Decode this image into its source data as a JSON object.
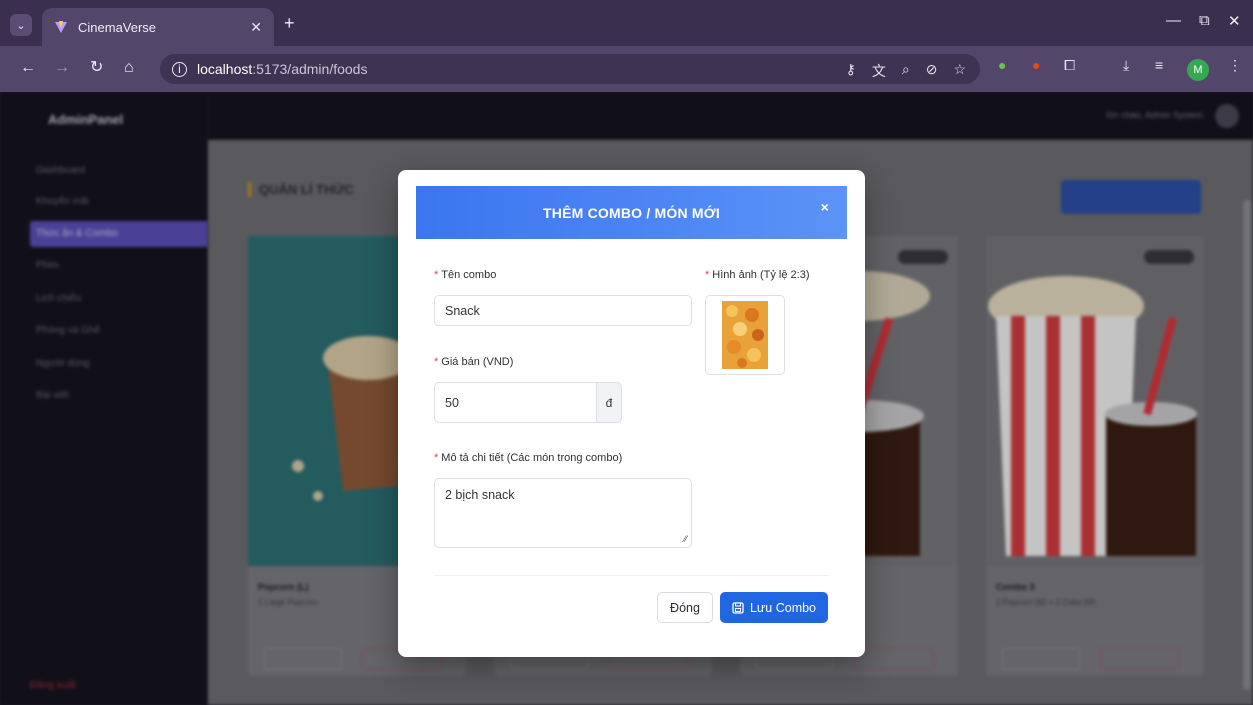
{
  "browser": {
    "tab_title": "CinemaVerse",
    "url_host": "localhost",
    "url_path": ":5173/admin/foods",
    "profile_initial": "M"
  },
  "app": {
    "brand": "AdminPanel",
    "sidebar": [
      {
        "label": "Dashboard",
        "active": false
      },
      {
        "label": "Khuyến mãi",
        "active": false
      },
      {
        "label": "Thức ăn & Combo",
        "active": true
      },
      {
        "label": "Phim",
        "active": false
      },
      {
        "label": "Lịch chiếu",
        "active": false
      },
      {
        "label": "Phòng và Ghế",
        "active": false
      },
      {
        "label": "Người dùng",
        "active": false
      },
      {
        "label": "Bài viết",
        "active": false
      }
    ],
    "logout": "Đăng xuất",
    "user": "Xin chào, Admin System",
    "page_title": "QUẢN LÍ THỨC",
    "cards": [
      {
        "name": "Popcorn (L)",
        "desc": "1 Large Popcorn"
      },
      {
        "name": "Combo 3",
        "desc": "2 Popcorn (M) + 2 Coke (M)"
      }
    ]
  },
  "modal": {
    "title": "THÊM COMBO / MÓN MỚI",
    "close_icon": "×",
    "name_label": "Tên combo",
    "name_value": "Snack",
    "image_label": "Hình ảnh (Tỷ lệ 2:3)",
    "price_label": "Giá bán (VND)",
    "price_value": "50",
    "currency": "đ",
    "desc_label": "Mô tả chi tiết (Các món trong combo)",
    "desc_value": "2 bịch snack",
    "close_button": "Đóng",
    "save_button": "Lưu Combo",
    "required_mark": "*"
  },
  "colors": {
    "modal_header_start": "#3a76f0",
    "modal_header_end": "#5b93f7",
    "save_button": "#1f66e0",
    "required": "#e0434b",
    "sidebar_active": "#5b4fb8"
  }
}
